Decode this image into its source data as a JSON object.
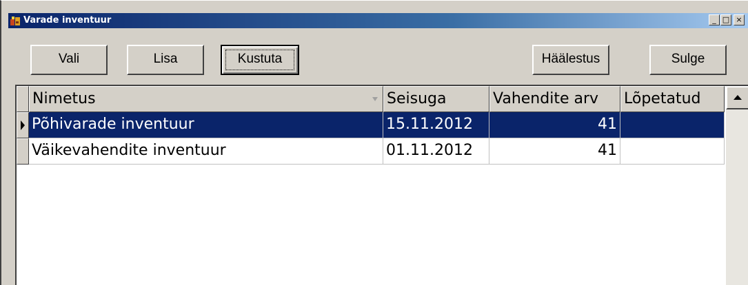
{
  "window": {
    "title": "Varade inventuur",
    "minimize_glyph": "_",
    "maximize_glyph": "□",
    "close_glyph": "×"
  },
  "toolbar": {
    "vali_label": "Vali",
    "lisa_label": "Lisa",
    "kustuta_label": "Kustuta",
    "haalestus_label": "Häälestus",
    "sulge_label": "Sulge"
  },
  "grid": {
    "columns": [
      "Nimetus",
      "Seisuga",
      "Vahendite arv",
      "Lõpetatud"
    ],
    "rows": [
      {
        "nimetus": "Põhivarade inventuur",
        "seisuga": "15.11.2012",
        "vahendite_arv": "41",
        "lopetatud": "",
        "selected": true
      },
      {
        "nimetus": "Väikevahendite inventuur",
        "seisuga": "01.11.2012",
        "vahendite_arv": "41",
        "lopetatud": "",
        "selected": false
      }
    ]
  },
  "colors": {
    "selection": "#0a246a",
    "face": "#d4d0c8"
  }
}
